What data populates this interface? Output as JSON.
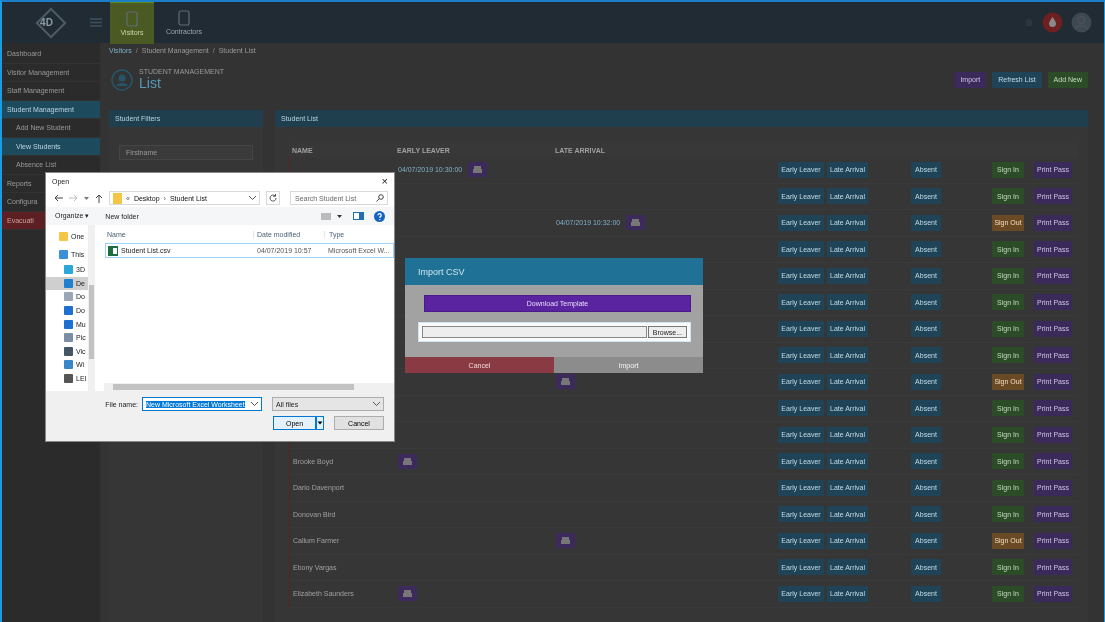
{
  "topbar": {
    "logo": "4D",
    "tabs": [
      {
        "label": "Visitors",
        "selected": true
      },
      {
        "label": "Contractors",
        "selected": false
      }
    ]
  },
  "sidebar": {
    "items": [
      {
        "label": "Dashboard",
        "kind": "main",
        "selected": false
      },
      {
        "label": "Visitor Management",
        "kind": "main",
        "selected": false
      },
      {
        "label": "Staff Management",
        "kind": "main",
        "selected": false
      },
      {
        "label": "Student Management",
        "kind": "main",
        "selected": true
      },
      {
        "label": "Add New Student",
        "kind": "sub",
        "selected": false
      },
      {
        "label": "View Students",
        "kind": "sub",
        "selected": true
      },
      {
        "label": "Absence List",
        "kind": "sub",
        "selected": false
      },
      {
        "label": "Reports",
        "kind": "main",
        "selected": false
      },
      {
        "label": "Configura",
        "kind": "main",
        "selected": false
      },
      {
        "label": "Evacuati",
        "kind": "alert",
        "selected": false
      }
    ]
  },
  "breadcrumb": [
    {
      "label": "Visitors",
      "kind": "link"
    },
    {
      "label": "/",
      "kind": "sep"
    },
    {
      "label": "Student Management",
      "kind": "link"
    },
    {
      "label": "/",
      "kind": "sep"
    },
    {
      "label": "Student List",
      "kind": "link"
    }
  ],
  "header": {
    "subtitle": "STUDENT MANAGEMENT",
    "title": "List",
    "buttons": [
      {
        "label": "Import",
        "kind": "purple"
      },
      {
        "label": "Refresh List",
        "kind": "blue"
      },
      {
        "label": "Add New",
        "kind": "green"
      }
    ]
  },
  "filters": {
    "title": "Student Filters",
    "fields": [
      {
        "placeholder": "Firstname"
      }
    ]
  },
  "student_list": {
    "title": "Student List",
    "columns": [
      "NAME",
      "EARLY LEAVER",
      "LATE ARRIVAL"
    ],
    "rows": [
      {
        "early": "04/07/2019 10:30:00",
        "early_print": true,
        "late_print": false,
        "signed_out": false,
        "actions": [
          "Early Leaver",
          "Late Arrival",
          "Absent",
          "Sign In",
          "Print Pass"
        ]
      },
      {
        "early_print": false,
        "late_print": false,
        "signed_out": false,
        "actions": [
          "Early Leaver",
          "Late Arrival",
          "Absent",
          "Sign In",
          "Print Pass"
        ]
      },
      {
        "late": "04/07/2019 10:32:00",
        "early_print": false,
        "late_print": true,
        "signed_out": true,
        "actions": [
          "Early Leaver",
          "Late Arrival",
          "Absent",
          "Sign Out",
          "Print Pass"
        ]
      },
      {
        "early_print": false,
        "late_print": false,
        "signed_out": false,
        "actions": [
          "Early Leaver",
          "Late Arrival",
          "Absent",
          "Sign In",
          "Print Pass"
        ]
      },
      {
        "early_print": false,
        "late_print": false,
        "signed_out": false,
        "actions": [
          "Early Leaver",
          "Late Arrival",
          "Absent",
          "Sign In",
          "Print Pass"
        ]
      },
      {
        "early_print": false,
        "late_print": false,
        "signed_out": false,
        "actions": [
          "Early Leaver",
          "Late Arrival",
          "Absent",
          "Sign In",
          "Print Pass"
        ]
      },
      {
        "early_print": false,
        "late_print": false,
        "signed_out": false,
        "actions": [
          "Early Leaver",
          "Late Arrival",
          "Absent",
          "Sign In",
          "Print Pass"
        ]
      },
      {
        "early_print": false,
        "late_print": false,
        "signed_out": false,
        "actions": [
          "Early Leaver",
          "Late Arrival",
          "Absent",
          "Sign In",
          "Print Pass"
        ]
      },
      {
        "early_print": false,
        "late_print": true,
        "signed_out": true,
        "actions": [
          "Early Leaver",
          "Late Arrival",
          "Absent",
          "Sign Out",
          "Print Pass"
        ]
      },
      {
        "early_print": false,
        "late_print": false,
        "signed_out": false,
        "actions": [
          "Early Leaver",
          "Late Arrival",
          "Absent",
          "Sign In",
          "Print Pass"
        ]
      },
      {
        "early_print": false,
        "late_print": false,
        "signed_out": false,
        "actions": [
          "Early Leaver",
          "Late Arrival",
          "Absent",
          "Sign In",
          "Print Pass"
        ]
      },
      {
        "name": "Brooke Boyd",
        "early_print": true,
        "late_print": false,
        "signed_out": false,
        "actions": [
          "Early Leaver",
          "Late Arrival",
          "Absent",
          "Sign In",
          "Print Pass"
        ]
      },
      {
        "name": "Dario Davenport",
        "early_print": false,
        "late_print": false,
        "signed_out": false,
        "actions": [
          "Early Leaver",
          "Late Arrival",
          "Absent",
          "Sign In",
          "Print Pass"
        ]
      },
      {
        "name": "Donovan Bird",
        "early_print": false,
        "late_print": false,
        "signed_out": false,
        "actions": [
          "Early Leaver",
          "Late Arrival",
          "Absent",
          "Sign In",
          "Print Pass"
        ]
      },
      {
        "name": "Callum Farmer",
        "early_print": false,
        "late_print": true,
        "signed_out": true,
        "actions": [
          "Early Leaver",
          "Late Arrival",
          "Absent",
          "Sign Out",
          "Print Pass"
        ]
      },
      {
        "name": "Ebony Vargas",
        "early_print": false,
        "late_print": false,
        "signed_out": false,
        "actions": [
          "Early Leaver",
          "Late Arrival",
          "Absent",
          "Sign In",
          "Print Pass"
        ]
      },
      {
        "name": "Elizabeth Saunders",
        "early_print": true,
        "late_print": false,
        "signed_out": false,
        "actions": [
          "Early Leaver",
          "Late Arrival",
          "Absent",
          "Sign In",
          "Print Pass"
        ]
      }
    ]
  },
  "import_dialog": {
    "title": "Import CSV",
    "template_button": "Download Template",
    "browse_button": "Browse...",
    "cancel_button": "Cancel",
    "import_button": "Import"
  },
  "open_dialog": {
    "title": "Open",
    "close": "×",
    "path": [
      {
        "label": "«",
        "kind": "prefix"
      },
      {
        "label": "Desktop",
        "kind": "folder"
      },
      {
        "label": "›",
        "kind": "sep"
      },
      {
        "label": "Student List",
        "kind": "folder"
      }
    ],
    "search": {
      "placeholder": "Search Student List"
    },
    "organize": "Organize",
    "organize_caret": "▾",
    "new_folder": "New folder",
    "nav": [
      {
        "label": "One",
        "kind": "folder",
        "selected": false
      },
      {
        "label": "This",
        "kind": "pc",
        "selected": false
      },
      {
        "label": "3D",
        "kind": "cube",
        "selected": false
      },
      {
        "label": "De",
        "kind": "desktop",
        "selected": true
      },
      {
        "label": "Do",
        "kind": "doc",
        "selected": false
      },
      {
        "label": "Do",
        "kind": "download",
        "selected": false
      },
      {
        "label": "Mu",
        "kind": "music",
        "selected": false
      },
      {
        "label": "Pic",
        "kind": "pictures",
        "selected": false
      },
      {
        "label": "Vic",
        "kind": "video",
        "selected": false
      },
      {
        "label": "Wi",
        "kind": "windows",
        "selected": false
      },
      {
        "label": "LEI",
        "kind": "drive",
        "selected": false
      }
    ],
    "columns": [
      "Name",
      "Date modified",
      "Type"
    ],
    "files": [
      {
        "name": "Student List.csv",
        "date": "04/07/2019 10:57",
        "type": "Microsoft Excel W...",
        "selected": true
      }
    ],
    "file_name_label": "File name:",
    "file_name": "New Microsoft Excel Worksheet",
    "file_type": "All files",
    "open_button": "Open",
    "cancel_button": "Cancel"
  }
}
